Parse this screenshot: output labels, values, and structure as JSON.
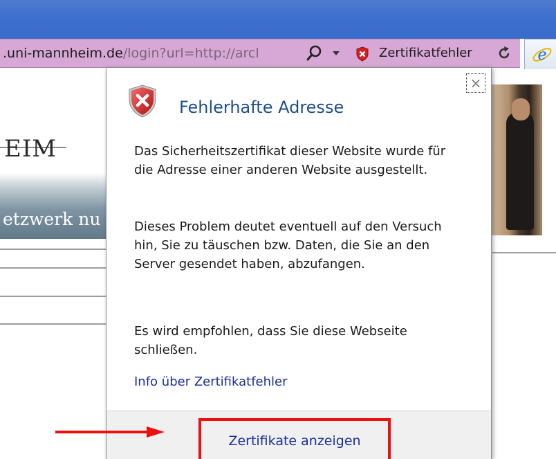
{
  "address_bar": {
    "url_host": ".uni-mannheim.de",
    "url_path": "/login?url=http://arcl",
    "status_text": "Zertifikatfehler"
  },
  "background_page": {
    "logo_text": "EIM",
    "banner_text": "etzwerk nu"
  },
  "dialog": {
    "title": "Fehlerhafte Adresse",
    "paragraph1": "Das Sicherheitszertifikat dieser Website wurde für die Adresse einer anderen Website ausgestellt.",
    "paragraph2": "Dieses Problem deutet eventuell auf den Versuch hin, Sie zu täuschen bzw. Daten, die Sie an den Server gesendet haben, abzufangen.",
    "paragraph3": "Es wird empfohlen, dass Sie diese Webseite schließen.",
    "info_link": "Info über Zertifikatfehler",
    "close_label": "×",
    "show_certificates_button": "Zertifikate anzeigen"
  },
  "colors": {
    "address_bar_bg": "#d7a8d5",
    "title_bar_bg": "#3c6fcf",
    "highlight_red": "#ee1010",
    "link_blue": "#1a2e99",
    "title_blue": "#1f4f8a"
  },
  "icons": {
    "search": "search-icon",
    "dropdown": "chevron-down-icon",
    "certificate_error": "shield-error-icon",
    "refresh": "refresh-icon",
    "browser": "internet-explorer-icon",
    "dialog_shield": "shield-x-icon",
    "close": "close-icon"
  }
}
